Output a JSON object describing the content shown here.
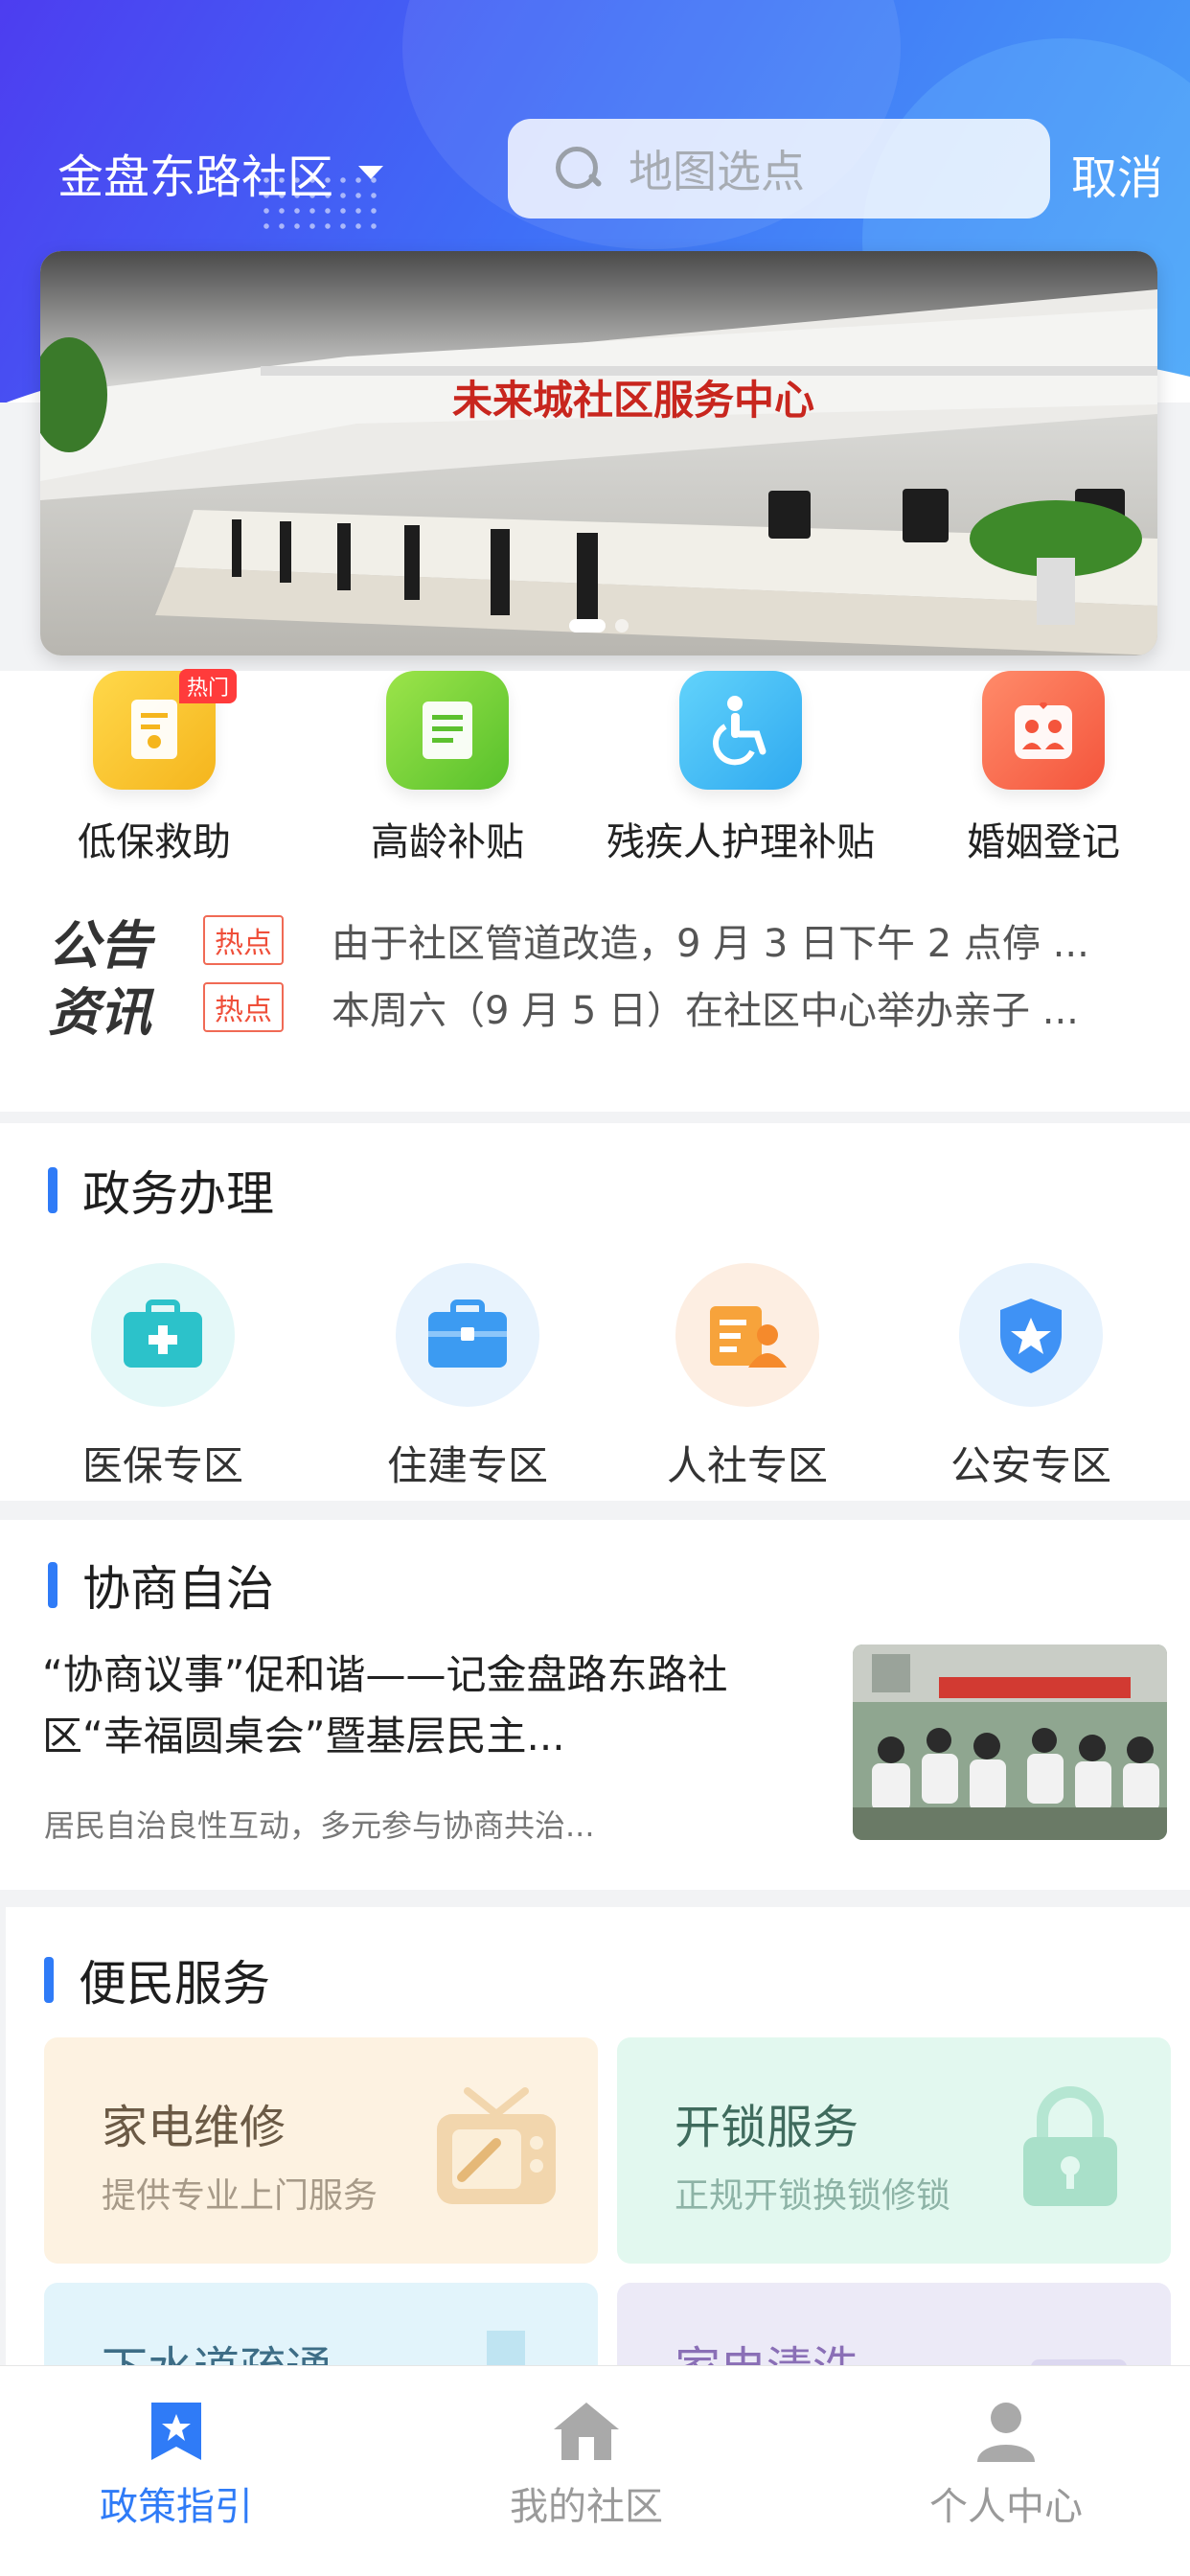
{
  "header": {
    "location": "金盘东路社区",
    "search_placeholder": "地图选点",
    "cancel": "取消"
  },
  "banner": {
    "sign_text": "未来城社区服务中心",
    "slides": 2,
    "active_slide": 1
  },
  "quick_services": [
    {
      "label": "低保救助",
      "icon": "document-icon",
      "color": "#f8c42c",
      "badge": "热门"
    },
    {
      "label": "高龄补贴",
      "icon": "book-icon",
      "color": "#7ed33c"
    },
    {
      "label": "残疾人护理补贴",
      "icon": "wheelchair-icon",
      "color": "#45c3f5"
    },
    {
      "label": "婚姻登记",
      "icon": "couple-icon",
      "color": "#fb6f4e"
    }
  ],
  "notices": {
    "logo_line1": "公告",
    "logo_line2": "资讯",
    "items": [
      {
        "tag": "热点",
        "text": "由于社区管道改造，9 月 3 日下午 2 点停 ..."
      },
      {
        "tag": "热点",
        "text": "本周六（9 月 5 日）在社区中心举办亲子 ..."
      }
    ]
  },
  "government": {
    "title": "政务办理",
    "items": [
      {
        "label": "医保专区",
        "icon": "medical-kit-icon",
        "color": "#2cc2ca",
        "bg": "#e6f8f9"
      },
      {
        "label": "住建专区",
        "icon": "briefcase-icon",
        "color": "#3c9bf2",
        "bg": "#e8f3fd"
      },
      {
        "label": "人社专区",
        "icon": "person-card-icon",
        "color": "#f7a33b",
        "bg": "#fdf0e3"
      },
      {
        "label": "公安专区",
        "icon": "police-shield-icon",
        "color": "#3f92f5",
        "bg": "#e8f3fd"
      }
    ]
  },
  "consultation": {
    "title": "协商自治",
    "article_title": "“协商议事”促和谐——记金盘路东路社区“幸福圆桌会”暨基层民主...",
    "article_summary": "居民自治良性互动，多元参与协商共治..."
  },
  "services": {
    "title": "便民服务",
    "items": [
      {
        "name": "家电维修",
        "desc": "提供专业上门服务",
        "icon": "tv-repair-icon",
        "bg": "#fdf2e1",
        "name_color": "#6b5a45",
        "desc_color": "#a79a88"
      },
      {
        "name": "开锁服务",
        "desc": "正规开锁换锁修锁",
        "icon": "lock-icon",
        "bg": "#e2f8ef",
        "name_color": "#3f6b5d",
        "desc_color": "#8db3a6"
      },
      {
        "name": "下水道疏通",
        "desc": "",
        "icon": "pipe-icon",
        "bg": "#e2f4fb",
        "name_color": "#3d6d86",
        "desc_color": "#8fb1c4"
      },
      {
        "name": "家电清洗",
        "desc": "",
        "icon": "cleaning-icon",
        "bg": "#eceaf7",
        "name_color": "#8a6fb6",
        "desc_color": "#aaa"
      }
    ]
  },
  "tabbar": {
    "items": [
      {
        "label": "政策指引",
        "icon": "bookmark-star-icon",
        "active": true
      },
      {
        "label": "我的社区",
        "icon": "home-icon",
        "active": false
      },
      {
        "label": "个人中心",
        "icon": "user-icon",
        "active": false
      }
    ],
    "active_color": "#2f7bf7",
    "inactive_color": "#9a9a9a"
  }
}
